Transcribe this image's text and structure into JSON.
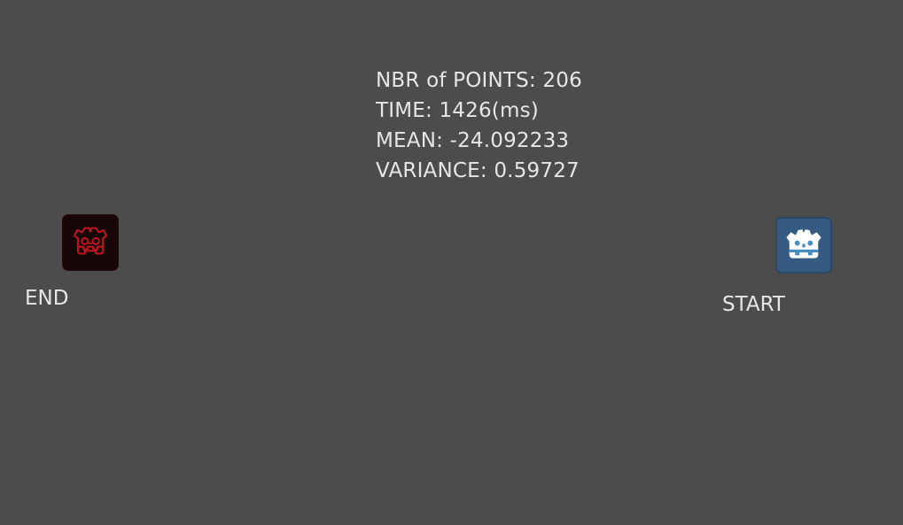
{
  "stats": {
    "points": "NBR of POINTS: 206",
    "time": "TIME: 1426(ms)",
    "mean": "MEAN: -24.092233",
    "variance": "VARIANCE: 0.59727"
  },
  "end_node": {
    "icon": "godot-robot-icon",
    "label": "END",
    "color": "#c0141e"
  },
  "start_node": {
    "icon": "godot-robot-icon",
    "label": "START",
    "color": "#478cbf"
  },
  "colors": {
    "background": "#4c4c4c",
    "text": "#e6e6e6"
  }
}
